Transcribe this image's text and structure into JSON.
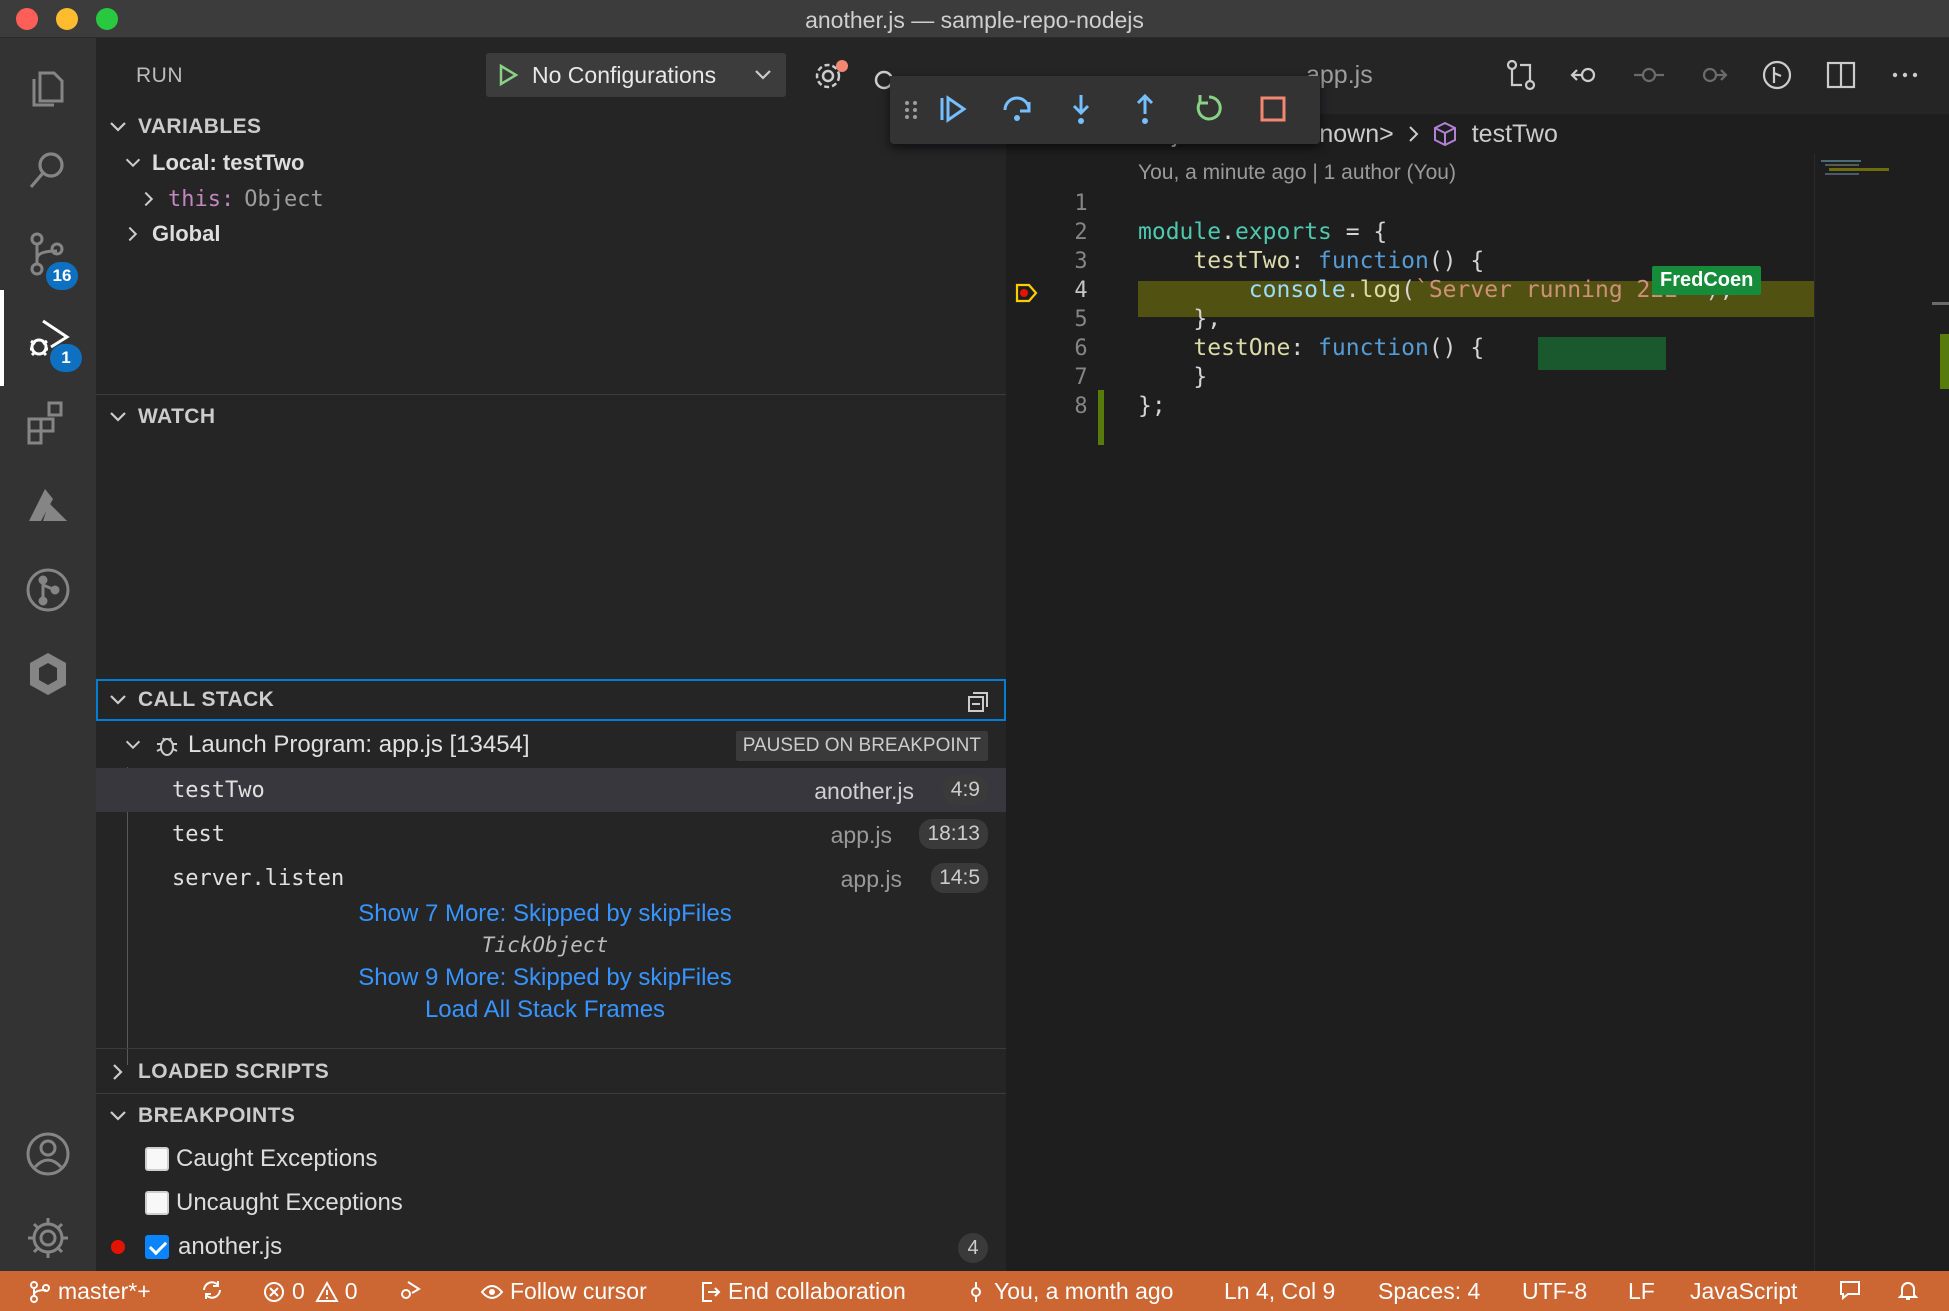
{
  "window": {
    "title": "another.js — sample-repo-nodejs"
  },
  "activity_bar": {
    "scm_badge": "16",
    "debug_badge": "1"
  },
  "run_panel": {
    "title": "RUN",
    "config_label": "No Configurations"
  },
  "variables": {
    "title": "VARIABLES",
    "local_scope": "Local: testTwo",
    "this_key": "this:",
    "this_value": "Object",
    "global_scope": "Global"
  },
  "watch": {
    "title": "WATCH"
  },
  "call_stack": {
    "title": "CALL STACK",
    "session_name": "Launch Program: app.js [13454]",
    "session_state": "PAUSED ON BREAKPOINT",
    "frames": [
      {
        "name": "testTwo",
        "file": "another.js",
        "pos": "4:9"
      },
      {
        "name": "test",
        "file": "app.js",
        "pos": "18:13"
      },
      {
        "name": "server.listen",
        "file": "app.js",
        "pos": "14:5"
      }
    ],
    "show_more_1": "Show 7 More: Skipped by skipFiles",
    "tick_object": "TickObject",
    "show_more_2": "Show 9 More: Skipped by skipFiles",
    "load_all": "Load All Stack Frames"
  },
  "loaded_scripts": {
    "title": "LOADED SCRIPTS"
  },
  "breakpoints": {
    "title": "BREAKPOINTS",
    "items": [
      {
        "label": "Caught Exceptions",
        "checked": false
      },
      {
        "label": "Uncaught Exceptions",
        "checked": false
      },
      {
        "label": "another.js",
        "checked": true,
        "line": "4"
      }
    ]
  },
  "editor": {
    "background_tab": "app.js",
    "breadcrumb": {
      "file": "another.js",
      "symbol1": "<unknown>",
      "symbol2": "testTwo"
    },
    "blame": "You, a minute ago | 1 author (You)",
    "collaborator": "FredCoen",
    "line_numbers": [
      "1",
      "2",
      "3",
      "4",
      "5",
      "6",
      "7",
      "8"
    ],
    "code": {
      "l2_a": "module",
      "l2_b": ".",
      "l2_c": "exports",
      "l2_d": " = {",
      "l3_a": "    testTwo",
      "l3_b": ": ",
      "l3_c": "function",
      "l3_d": "() {",
      "l4_a": "        console",
      "l4_b": ".",
      "l4_c": "log",
      "l4_d": "(",
      "l4_e": "`Server running 222 `",
      "l4_f": ");",
      "l5": "    },",
      "l6_a": "    testOne",
      "l6_b": ": ",
      "l6_c": "function",
      "l6_d": "() {",
      "l7": "    }",
      "l8": "};"
    }
  },
  "status_bar": {
    "branch": "master*+",
    "errors": "0",
    "warnings": "0",
    "follow": "Follow cursor",
    "end_collab": "End collaboration",
    "blame": "You, a month ago",
    "position": "Ln 4, Col 9",
    "spaces": "Spaces: 4",
    "encoding": "UTF-8",
    "eol": "LF",
    "language": "JavaScript"
  },
  "colors": {
    "status_bar": "#cc6633",
    "accent": "#007fd4",
    "link": "#3794ff",
    "collaborator": "#168b3a"
  }
}
